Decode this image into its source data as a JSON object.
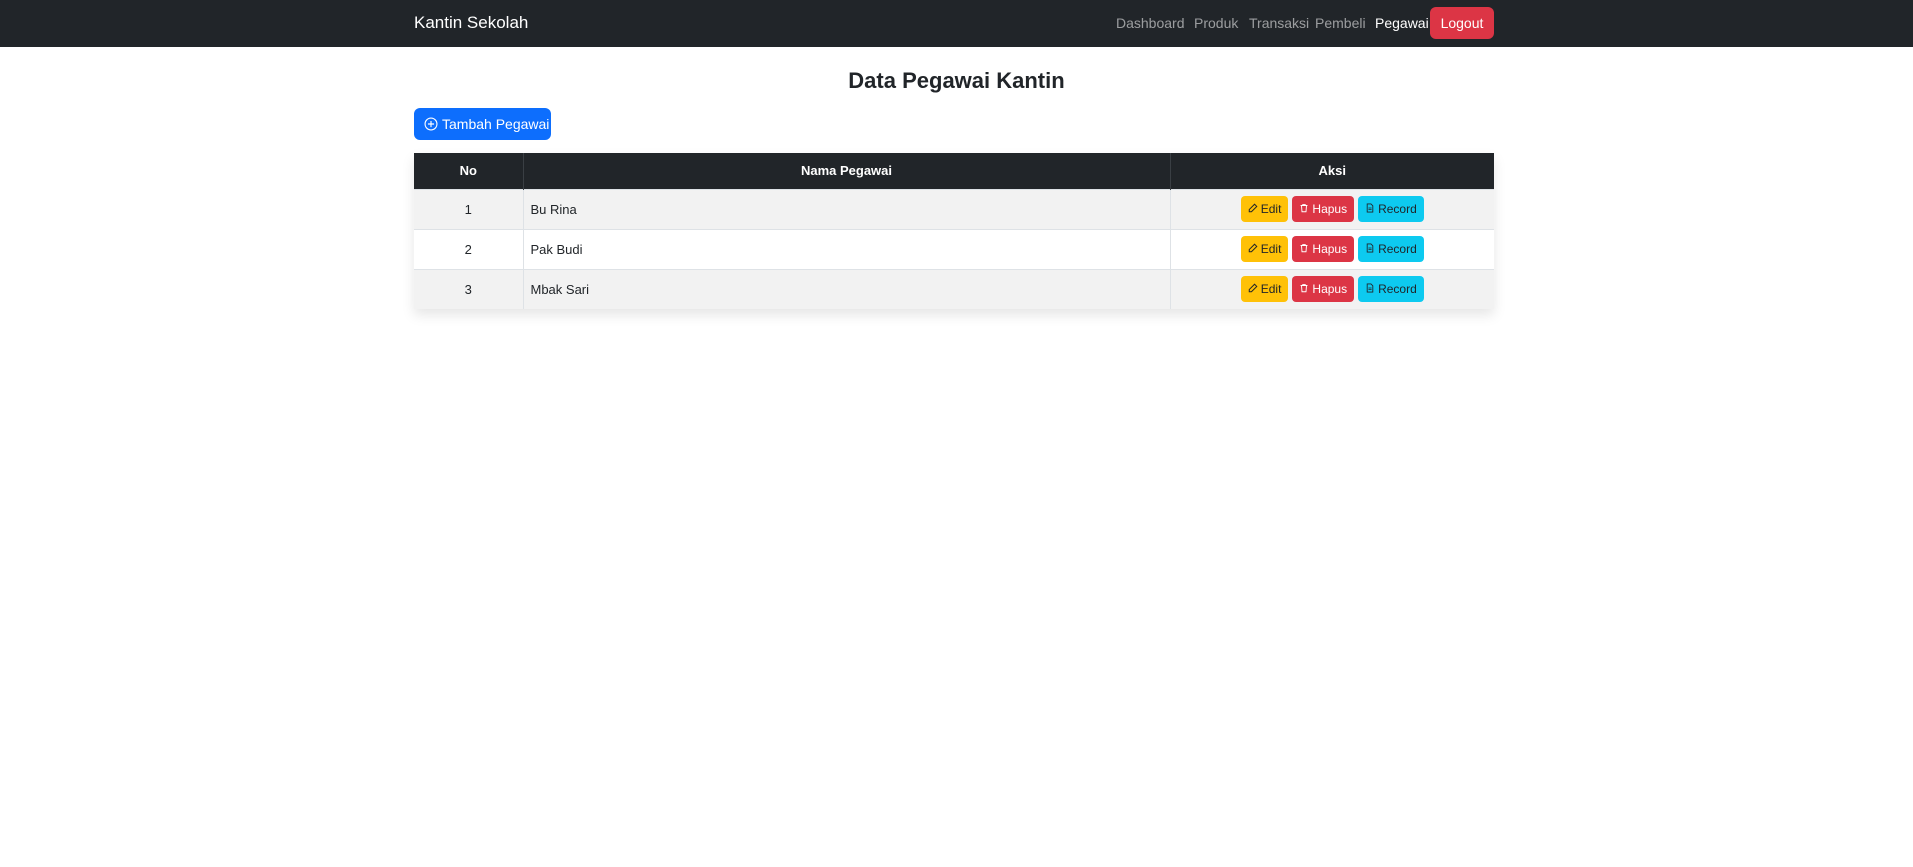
{
  "navbar": {
    "brand": "Kantin Sekolah",
    "links": [
      "Dashboard",
      "Produk",
      "Transaksi",
      "Pembeli",
      "Pegawai"
    ],
    "active": "Pegawai",
    "logout_label": "Logout"
  },
  "page": {
    "title": "Data Pegawai Kantin",
    "add_button_label": "Tambah Pegawai"
  },
  "table": {
    "headers": [
      "No",
      "Nama Pegawai",
      "Aksi"
    ],
    "rows": [
      {
        "no": "1",
        "nama": "Bu Rina"
      },
      {
        "no": "2",
        "nama": "Pak Budi"
      },
      {
        "no": "3",
        "nama": "Mbak Sari"
      }
    ],
    "actions": {
      "edit": "Edit",
      "hapus": "Hapus",
      "record": "Record"
    }
  },
  "icons": {
    "add": "plus-circle-icon",
    "edit": "pencil-square-icon",
    "hapus": "trash-icon",
    "record": "file-text-icon"
  },
  "colors": {
    "navbar": "#212529",
    "primary": "#0d6efd",
    "danger": "#dc3545",
    "warning": "#ffc107",
    "info": "#0dcaf0"
  }
}
